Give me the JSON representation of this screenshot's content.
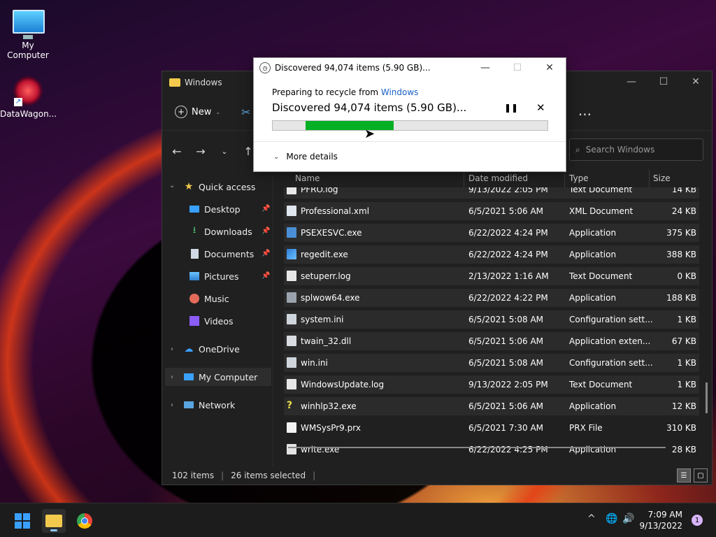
{
  "desktop": {
    "icons": [
      {
        "label": "My Computer"
      },
      {
        "label": "DataWagon..."
      }
    ]
  },
  "explorer": {
    "title": "Windows",
    "toolbar": {
      "new_label": "New",
      "more_label": "..."
    },
    "search": {
      "placeholder": "Search Windows"
    },
    "sidebar": {
      "quick_access": "Quick access",
      "items": [
        {
          "label": "Desktop"
        },
        {
          "label": "Downloads"
        },
        {
          "label": "Documents"
        },
        {
          "label": "Pictures"
        },
        {
          "label": "Music"
        },
        {
          "label": "Videos"
        }
      ],
      "onedrive": "OneDrive",
      "my_computer": "My Computer",
      "network": "Network"
    },
    "columns": {
      "name": "Name",
      "date": "Date modified",
      "type": "Type",
      "size": "Size"
    },
    "rows": [
      {
        "name": "PFRO.log",
        "date": "9/13/2022 2:05 PM",
        "type": "Text Document",
        "size": "14 KB"
      },
      {
        "name": "Professional.xml",
        "date": "6/5/2021 5:06 AM",
        "type": "XML Document",
        "size": "24 KB"
      },
      {
        "name": "PSEXESVC.exe",
        "date": "6/22/2022 4:24 PM",
        "type": "Application",
        "size": "375 KB"
      },
      {
        "name": "regedit.exe",
        "date": "6/22/2022 4:24 PM",
        "type": "Application",
        "size": "388 KB"
      },
      {
        "name": "setuperr.log",
        "date": "2/13/2022 1:16 AM",
        "type": "Text Document",
        "size": "0 KB"
      },
      {
        "name": "splwow64.exe",
        "date": "6/22/2022 4:22 PM",
        "type": "Application",
        "size": "188 KB"
      },
      {
        "name": "system.ini",
        "date": "6/5/2021 5:08 AM",
        "type": "Configuration sett...",
        "size": "1 KB"
      },
      {
        "name": "twain_32.dll",
        "date": "6/5/2021 5:06 AM",
        "type": "Application exten...",
        "size": "67 KB"
      },
      {
        "name": "win.ini",
        "date": "6/5/2021 5:08 AM",
        "type": "Configuration sett...",
        "size": "1 KB"
      },
      {
        "name": "WindowsUpdate.log",
        "date": "9/13/2022 2:05 PM",
        "type": "Text Document",
        "size": "1 KB"
      },
      {
        "name": "winhlp32.exe",
        "date": "6/5/2021 5:06 AM",
        "type": "Application",
        "size": "12 KB"
      },
      {
        "name": "WMSysPr9.prx",
        "date": "6/5/2021 7:30 AM",
        "type": "PRX File",
        "size": "310 KB"
      },
      {
        "name": "write.exe",
        "date": "6/22/2022 4:25 PM",
        "type": "Application",
        "size": "28 KB"
      }
    ],
    "status": {
      "items": "102 items",
      "selected": "26 items selected"
    }
  },
  "dialog": {
    "title": "Discovered 94,074 items (5.90 GB)...",
    "preparing": "Preparing to recycle from",
    "source_link": "Windows",
    "status": "Discovered 94,074 items (5.90 GB)...",
    "progress_start": 0.12,
    "progress_end": 0.44,
    "more_details": "More details"
  },
  "taskbar": {
    "time": "7:09 AM",
    "date": "9/13/2022",
    "notifications": "1"
  },
  "colors": {
    "progress_fill": "#06b025",
    "link": "#1a63c8",
    "accent": "#3aa0ff"
  }
}
